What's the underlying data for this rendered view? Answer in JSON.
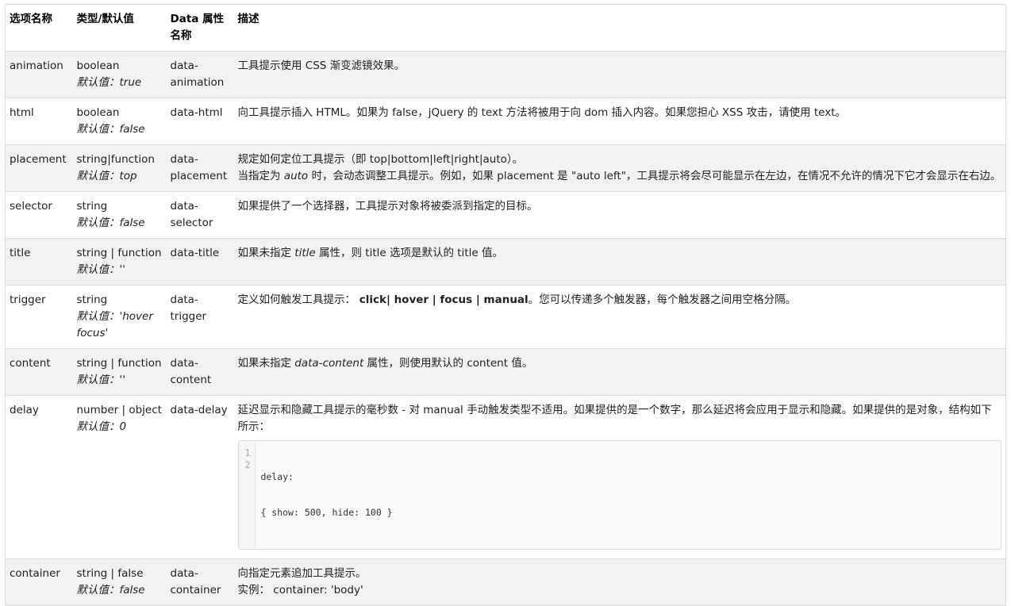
{
  "headers": {
    "name": "选项名称",
    "type": "类型/默认值",
    "data_attr": "Data 属性名称",
    "desc": "描述"
  },
  "default_prefix": "默认值：",
  "rows": {
    "animation": {
      "name": "animation",
      "type": "boolean",
      "default": "true",
      "attr": "data-animation",
      "desc": "工具提示使用 CSS 渐变滤镜效果。"
    },
    "html": {
      "name": "html",
      "type": "boolean",
      "default": "false",
      "attr": "data-html",
      "desc": "向工具提示插入 HTML。如果为 false，jQuery 的 text 方法将被用于向 dom 插入内容。如果您担心 XSS 攻击，请使用 text。"
    },
    "placement": {
      "name": "placement",
      "type": "string|function",
      "default": "top",
      "attr": "data-placement",
      "desc_1": "规定如何定位工具提示（即 top|bottom|left|right|auto）。",
      "desc_2_pre": "当指定为 ",
      "desc_2_em": "auto",
      "desc_2_post": " 时，会动态调整工具提示。例如，如果 placement 是 \"auto left\"，工具提示将会尽可能显示在左边，在情况不允许的情况下它才会显示在右边。"
    },
    "selector": {
      "name": "selector",
      "type": "string",
      "default": "false",
      "attr": "data-selector",
      "desc": "如果提供了一个选择器，工具提示对象将被委派到指定的目标。"
    },
    "title": {
      "name": "title",
      "type": "string | function",
      "default": "''",
      "attr": "data-title",
      "desc_pre": "如果未指定 ",
      "desc_em": "title",
      "desc_post": " 属性，则 title 选项是默认的 title 值。"
    },
    "trigger": {
      "name": "trigger",
      "type": "string",
      "default": "'hover focus'",
      "attr": "data-trigger",
      "desc_pre": "定义如何触发工具提示：",
      "desc_strong": " click| hover | focus | manual",
      "desc_post": "。您可以传递多个触发器，每个触发器之间用空格分隔。"
    },
    "content": {
      "name": "content",
      "type": "string | function",
      "default": "''",
      "attr": "data-content",
      "desc_pre": "如果未指定 ",
      "desc_em": "data-content",
      "desc_post": " 属性，则使用默认的 content 值。"
    },
    "delay": {
      "name": "delay",
      "type": "number | object",
      "default": "0",
      "attr": "data-delay",
      "desc": "延迟显示和隐藏工具提示的毫秒数 - 对 manual 手动触发类型不适用。如果提供的是一个数字，那么延迟将会应用于显示和隐藏。如果提供的是对象，结构如下所示：",
      "code_line_numbers": [
        "1",
        "2"
      ],
      "code_lines": [
        "delay:",
        "{ show: 500, hide: 100 }"
      ]
    },
    "container": {
      "name": "container",
      "type": "string | false",
      "default": "false",
      "attr": "data-container",
      "desc_1": "向指定元素追加工具提示。",
      "desc_2": "实例： container: 'body'"
    }
  }
}
